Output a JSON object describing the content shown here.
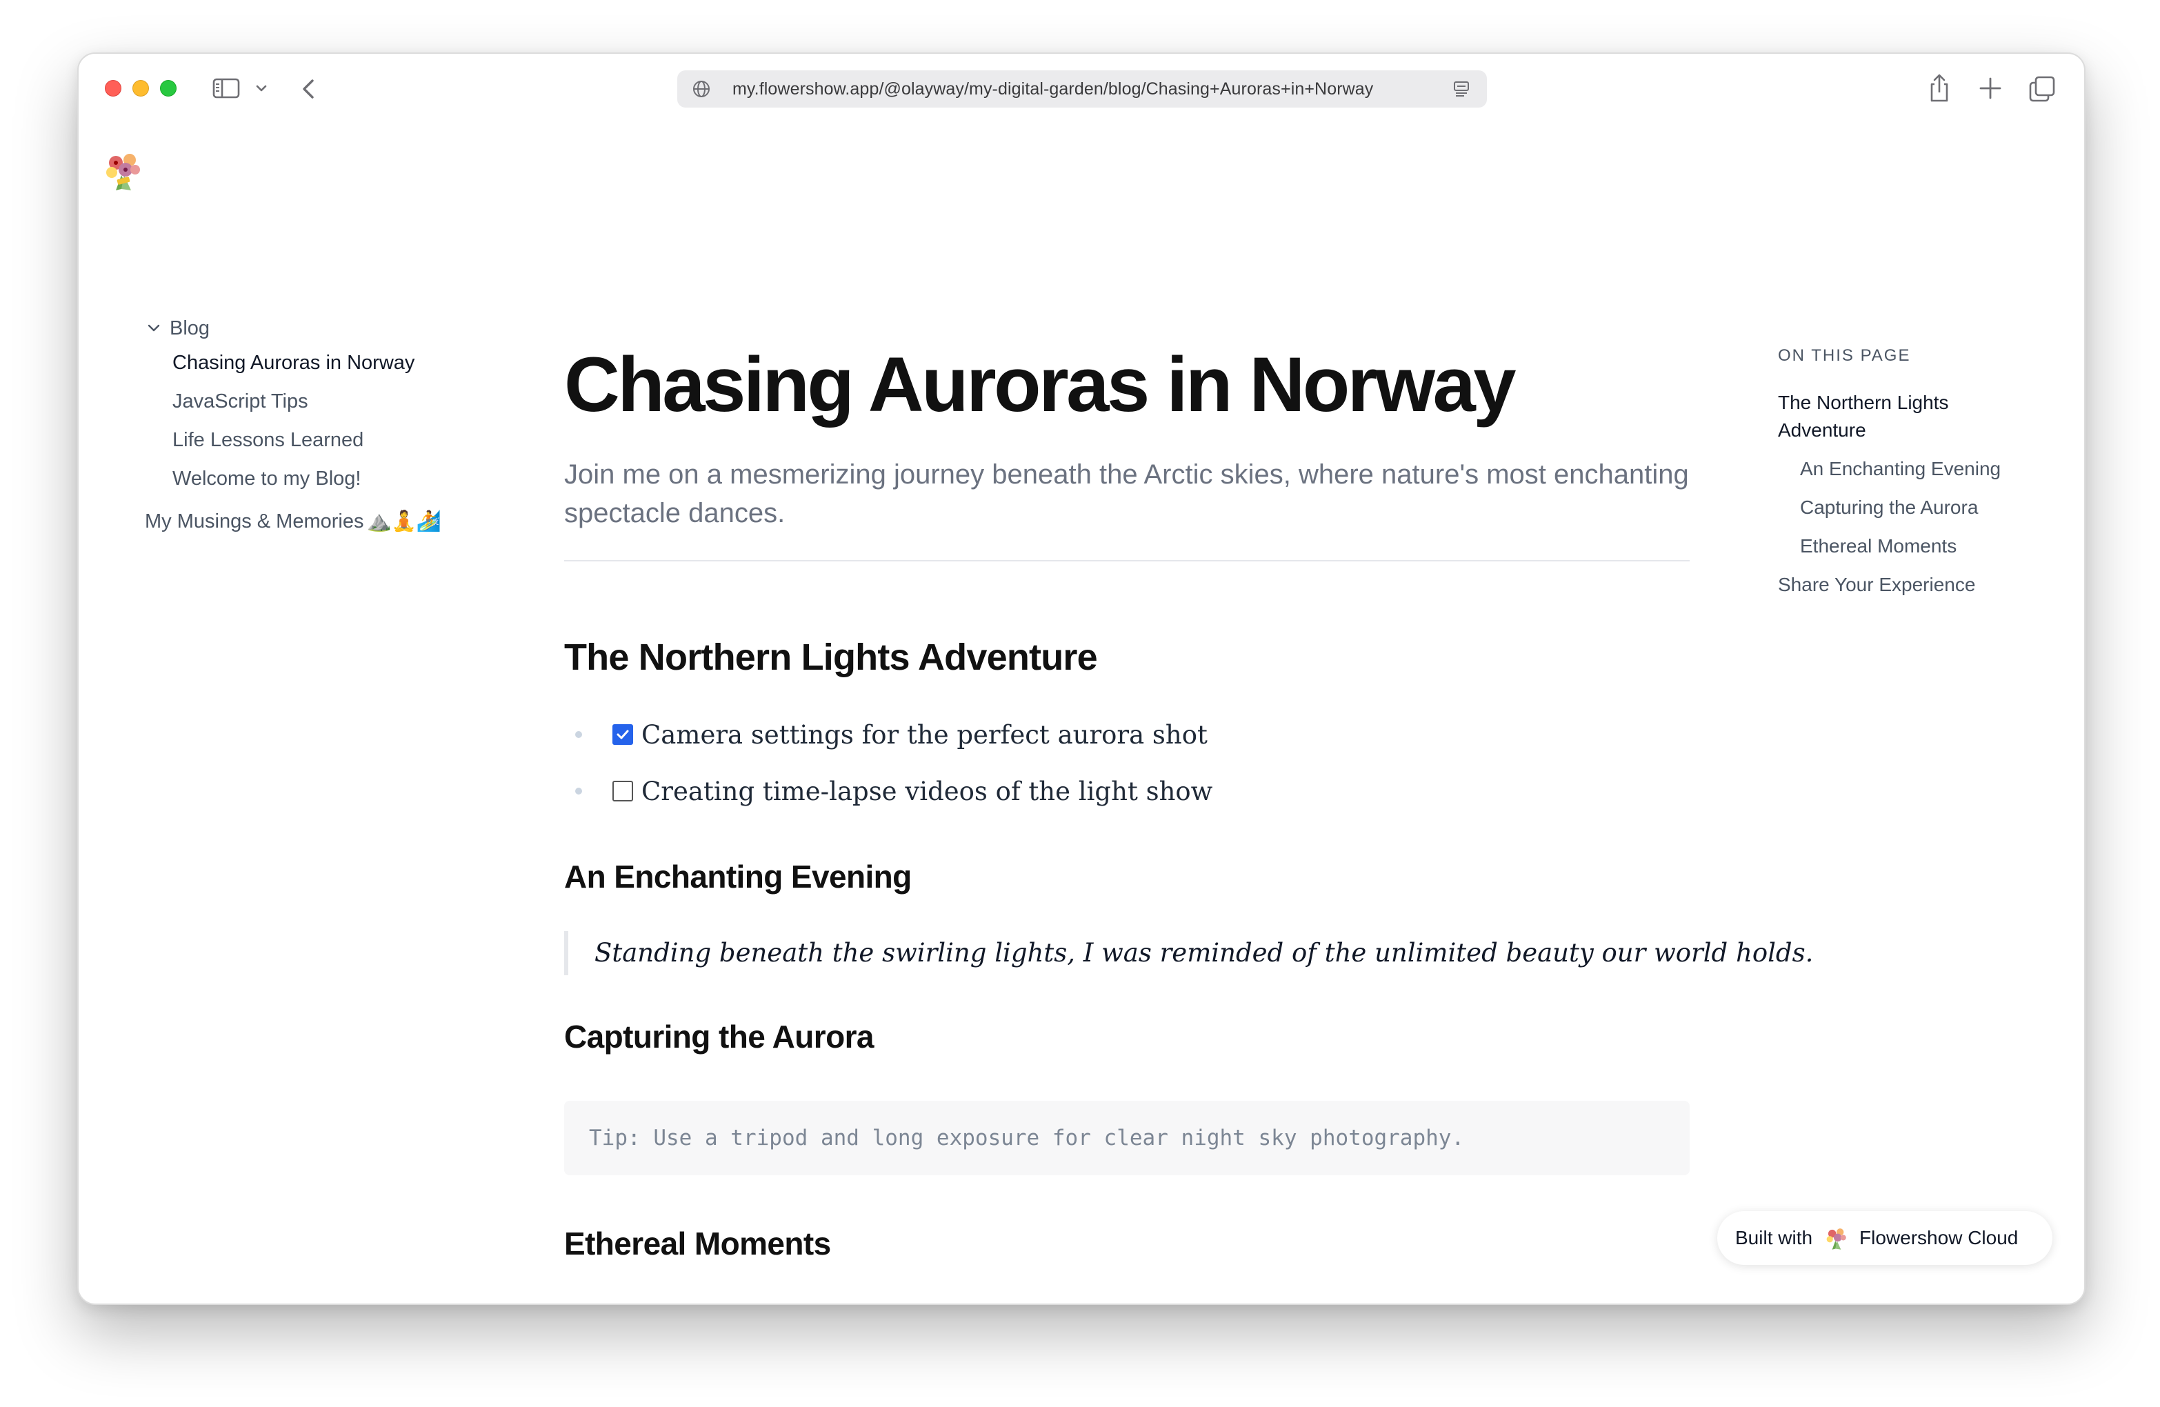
{
  "browser": {
    "url": "my.flowershow.app/@olayway/my-digital-garden/blog/Chasing+Auroras+in+Norway"
  },
  "sidebar": {
    "group_label": "Blog",
    "items": [
      {
        "label": "Chasing Auroras in Norway",
        "active": true
      },
      {
        "label": "JavaScript Tips",
        "active": false
      },
      {
        "label": "Life Lessons Learned",
        "active": false
      },
      {
        "label": "Welcome to my Blog!",
        "active": false
      }
    ],
    "musings": {
      "label": "My Musings & Memories",
      "emoji": "⛰️🧘🏄"
    }
  },
  "article": {
    "title": "Chasing Auroras in Norway",
    "subtitle": "Join me on a mesmerizing journey beneath the Arctic skies, where nature's most enchanting spectacle dances.",
    "section1_heading": "The Northern Lights Adventure",
    "tasks": [
      {
        "text": "Camera settings for the perfect aurora shot",
        "checked": true
      },
      {
        "text": "Creating time-lapse videos of the light show",
        "checked": false
      }
    ],
    "section2_heading": "An Enchanting Evening",
    "quote": "Standing beneath the swirling lights, I was reminded of the unlimited beauty our world holds.",
    "section3_heading": "Capturing the Aurora",
    "code": "Tip: Use a tripod and long exposure for clear night sky photography.",
    "section4_heading": "Ethereal Moments"
  },
  "toc": {
    "heading": "ON THIS PAGE",
    "items": [
      {
        "label": "The Northern Lights Adventure",
        "level": 1
      },
      {
        "label": "An Enchanting Evening",
        "level": 2
      },
      {
        "label": "Capturing the Aurora",
        "level": 2
      },
      {
        "label": "Ethereal Moments",
        "level": 2
      },
      {
        "label": "Share Your Experience",
        "level": 1
      }
    ]
  },
  "footer_badge": {
    "prefix": "Built with",
    "product": "Flowershow Cloud"
  },
  "colors": {
    "accent_checkbox": "#2563eb",
    "traffic_red": "#ff5f57",
    "traffic_yellow": "#febc2e",
    "traffic_green": "#28c840"
  },
  "icons": [
    "sidebar-toggle-icon",
    "chevron-down-icon",
    "back-chevron-icon",
    "globe-icon",
    "reader-icon",
    "share-icon",
    "plus-icon",
    "tabs-icon",
    "flower-bouquet-logo"
  ]
}
